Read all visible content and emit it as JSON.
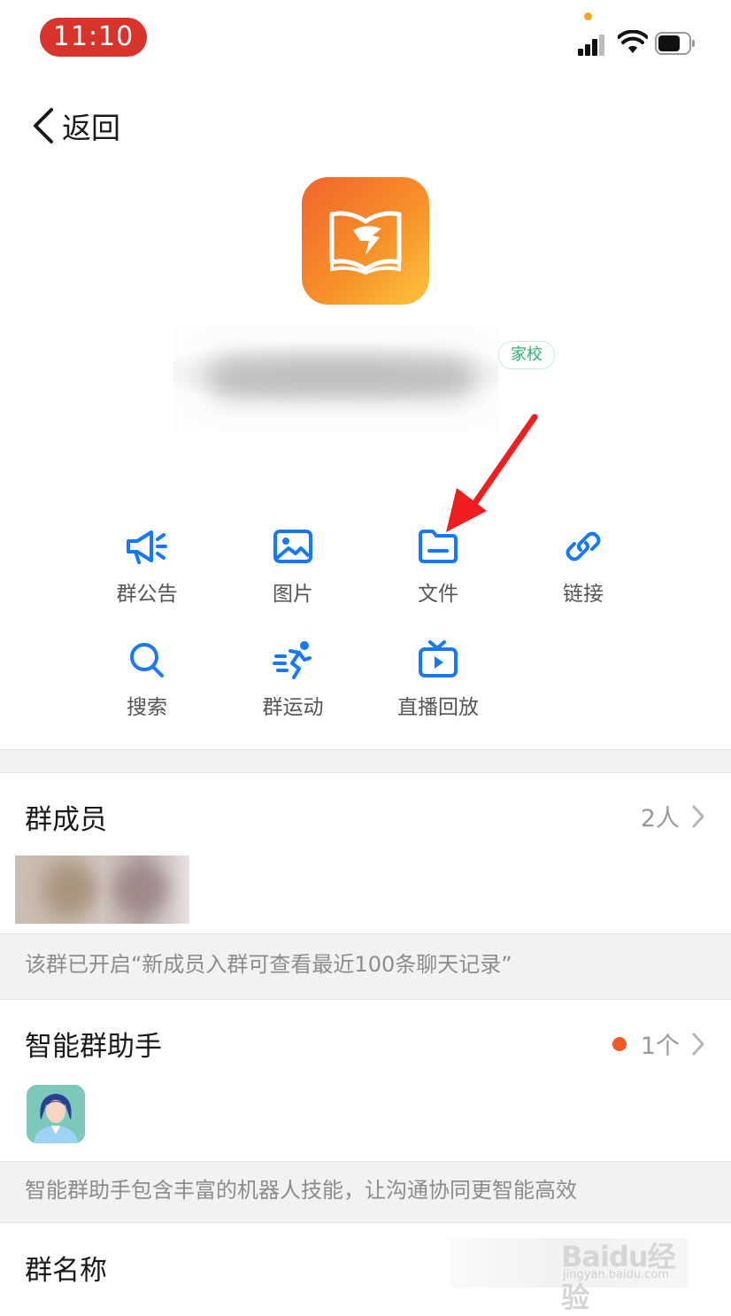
{
  "status_bar": {
    "time": "11:10",
    "icons": [
      "signal-icon",
      "wifi-icon",
      "battery-icon"
    ]
  },
  "nav": {
    "back_label": "返回"
  },
  "group": {
    "tag": "家校"
  },
  "functions": [
    {
      "label": "群公告",
      "icon": "megaphone-icon"
    },
    {
      "label": "图片",
      "icon": "image-icon"
    },
    {
      "label": "文件",
      "icon": "folder-icon"
    },
    {
      "label": "链接",
      "icon": "link-icon"
    },
    {
      "label": "搜索",
      "icon": "search-icon"
    },
    {
      "label": "群运动",
      "icon": "running-icon"
    },
    {
      "label": "直播回放",
      "icon": "tv-playback-icon"
    }
  ],
  "members": {
    "title": "群成员",
    "count": "2人",
    "note": "该群已开启“新成员入群可查看最近100条聊天记录”"
  },
  "assistant": {
    "title": "智能群助手",
    "count": "1个",
    "note": "智能群助手包含丰富的机器人技能，让沟通协同更智能高效"
  },
  "group_name": {
    "title": "群名称"
  },
  "watermark": {
    "brand": "Baidu经验",
    "url": "jingyan.baidu.com"
  },
  "colors": {
    "accent": "#1677ff",
    "time_pill": "#d9342b",
    "tag_green": "#2bb673",
    "annotation_red": "#f01e1e",
    "unread_dot": "#f25a24"
  }
}
